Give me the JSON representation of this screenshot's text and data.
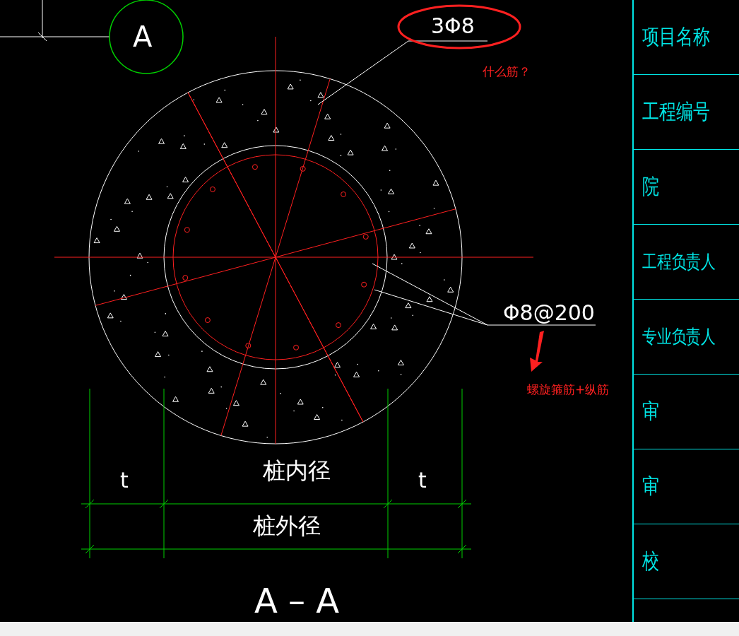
{
  "section_marker": "A",
  "top_rebar_label": "3Φ8",
  "question_note": "什么筋？",
  "spiral_rebar_label": "Φ8@200",
  "answer_note": "螺旋箍筋+纵筋",
  "dimensions": {
    "wall_left": "t",
    "wall_right": "t",
    "inner_label": "桩内径",
    "outer_label": "桩外径"
  },
  "section_title": "A – A",
  "title_block": [
    "项目名称",
    "工程编号",
    "院",
    "工程负责人",
    "专业负责人",
    "审",
    "审",
    "校"
  ]
}
